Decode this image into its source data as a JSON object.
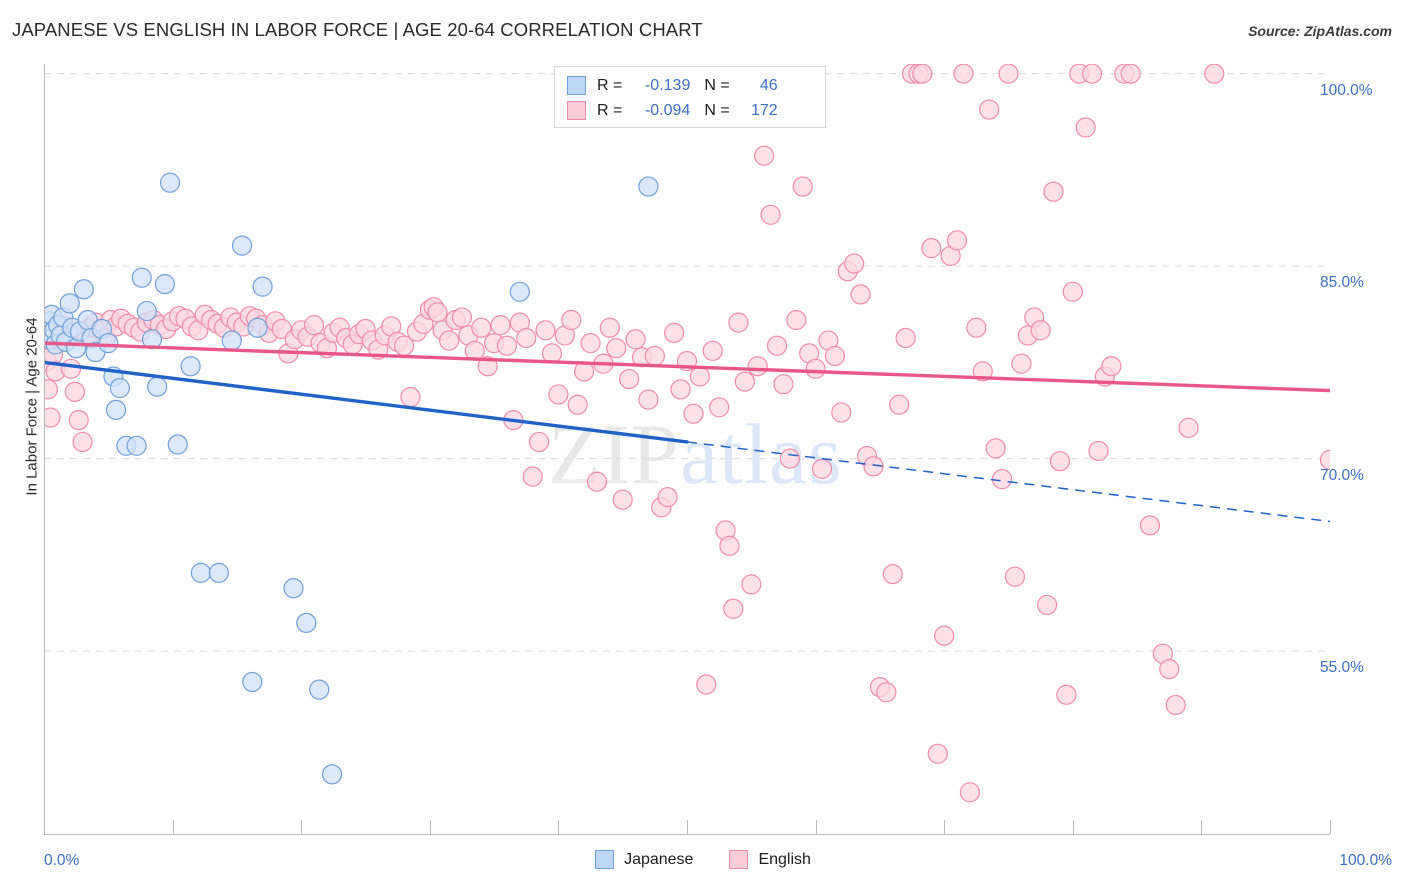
{
  "header": {
    "title": "JAPANESE VS ENGLISH IN LABOR FORCE | AGE 20-64 CORRELATION CHART",
    "source": "Source: ZipAtlas.com"
  },
  "watermark": {
    "part1": "ZIP",
    "part2": "atlas"
  },
  "stats_legend": {
    "rows": [
      {
        "series": "Japanese",
        "color": "#bcd6f5",
        "r_label": "R =",
        "r_value": "-0.139",
        "n_label": "N =",
        "n_value": "46"
      },
      {
        "series": "English",
        "color": "#fbccd9",
        "r_label": "R =",
        "r_value": "-0.094",
        "n_label": "N =",
        "n_value": "172"
      }
    ]
  },
  "series_legend": [
    {
      "label": "Japanese",
      "color": "#bcd6f5"
    },
    {
      "label": "English",
      "color": "#fbccd9"
    }
  ],
  "axes": {
    "y_title": "In Labor Force | Age 20-64",
    "y_ticks": [
      "100.0%",
      "85.0%",
      "70.0%",
      "55.0%"
    ],
    "x_min_label": "0.0%",
    "x_max_label": "100.0%"
  },
  "colors": {
    "blue_fill": "#cfe1f8",
    "blue_stroke": "#6f9fd8",
    "pink_fill": "#fcd7e2",
    "pink_stroke": "#f08aab",
    "blue_trend": "#1f63c8",
    "pink_trend": "#e8568a",
    "tick_text": "#3c6fc4",
    "grid": "#dcdcdc"
  },
  "chart_data": {
    "type": "scatter",
    "title": "JAPANESE VS ENGLISH IN LABOR FORCE | AGE 20-64 CORRELATION CHART",
    "xlabel": "",
    "ylabel": "In Labor Force | Age 20-64",
    "xlim": [
      0,
      100
    ],
    "ylim": [
      40.75,
      100.75
    ],
    "x_ticks": [
      0,
      10,
      20,
      30,
      40,
      50,
      60,
      70,
      80,
      90,
      100
    ],
    "y_gridlines": [
      100.0,
      85.0,
      70.0,
      55.0
    ],
    "grid": true,
    "legend_position": "bottom-center",
    "series": [
      {
        "name": "Japanese",
        "color": "#cfe1f8",
        "stroke": "#6f9fd8",
        "r": -0.139,
        "n": 46,
        "trend": {
          "x0": 0,
          "y0": 77.5,
          "x1": 50,
          "y1": 71.3,
          "solid_to_x": 50,
          "dashed_to": {
            "x": 100,
            "y": 65.1
          }
        },
        "points": [
          [
            0.2,
            79.8
          ],
          [
            0.4,
            80.7
          ],
          [
            0.5,
            79.3
          ],
          [
            0.6,
            81.2
          ],
          [
            0.8,
            80.0
          ],
          [
            0.9,
            78.9
          ],
          [
            1.1,
            80.4
          ],
          [
            1.3,
            79.6
          ],
          [
            1.5,
            81.0
          ],
          [
            1.7,
            79.1
          ],
          [
            2.0,
            82.1
          ],
          [
            2.2,
            80.2
          ],
          [
            2.5,
            78.6
          ],
          [
            2.8,
            79.9
          ],
          [
            3.1,
            83.2
          ],
          [
            3.4,
            80.8
          ],
          [
            3.7,
            79.4
          ],
          [
            4.0,
            78.3
          ],
          [
            4.5,
            80.1
          ],
          [
            5.0,
            79.0
          ],
          [
            5.4,
            76.4
          ],
          [
            5.6,
            73.8
          ],
          [
            5.9,
            75.5
          ],
          [
            6.4,
            71.0
          ],
          [
            7.2,
            71.0
          ],
          [
            7.6,
            84.1
          ],
          [
            8.0,
            81.5
          ],
          [
            8.4,
            79.3
          ],
          [
            8.8,
            75.6
          ],
          [
            9.4,
            83.6
          ],
          [
            9.8,
            91.5
          ],
          [
            10.4,
            71.1
          ],
          [
            11.4,
            77.2
          ],
          [
            12.2,
            61.1
          ],
          [
            13.6,
            61.1
          ],
          [
            14.6,
            79.2
          ],
          [
            15.4,
            86.6
          ],
          [
            16.2,
            52.6
          ],
          [
            16.6,
            80.2
          ],
          [
            17.0,
            83.4
          ],
          [
            19.4,
            59.9
          ],
          [
            20.4,
            57.2
          ],
          [
            21.4,
            52.0
          ],
          [
            22.4,
            45.4
          ],
          [
            37.0,
            83.0
          ],
          [
            47.0,
            91.2
          ]
        ]
      },
      {
        "name": "English",
        "color": "#fcd7e2",
        "stroke": "#f08aab",
        "r": -0.094,
        "n": 172,
        "trend": {
          "x0": 0,
          "y0": 79.0,
          "x1": 100,
          "y1": 75.3,
          "solid_to_x": 100
        },
        "points": [
          [
            0.2,
            77.6
          ],
          [
            0.3,
            75.4
          ],
          [
            0.5,
            73.2
          ],
          [
            0.7,
            78.1
          ],
          [
            0.9,
            76.8
          ],
          [
            1.2,
            79.2
          ],
          [
            1.5,
            80.4
          ],
          [
            1.8,
            79.8
          ],
          [
            2.1,
            77.0
          ],
          [
            2.4,
            75.2
          ],
          [
            2.7,
            73.0
          ],
          [
            3.0,
            71.3
          ],
          [
            3.3,
            79.6
          ],
          [
            3.6,
            80.2
          ],
          [
            4.0,
            80.6
          ],
          [
            4.4,
            80.1
          ],
          [
            4.8,
            79.4
          ],
          [
            5.2,
            80.8
          ],
          [
            5.6,
            80.3
          ],
          [
            6.0,
            80.9
          ],
          [
            6.5,
            80.5
          ],
          [
            7.0,
            80.2
          ],
          [
            7.5,
            79.9
          ],
          [
            8.0,
            80.6
          ],
          [
            8.5,
            80.8
          ],
          [
            9.0,
            80.4
          ],
          [
            9.5,
            80.1
          ],
          [
            10.0,
            80.7
          ],
          [
            10.5,
            81.1
          ],
          [
            11.0,
            80.9
          ],
          [
            11.5,
            80.3
          ],
          [
            12.0,
            80.0
          ],
          [
            12.5,
            81.2
          ],
          [
            13.0,
            80.8
          ],
          [
            13.5,
            80.5
          ],
          [
            14.0,
            80.2
          ],
          [
            14.5,
            81.0
          ],
          [
            15.0,
            80.6
          ],
          [
            15.5,
            80.3
          ],
          [
            16.0,
            81.1
          ],
          [
            16.5,
            80.9
          ],
          [
            17.0,
            80.4
          ],
          [
            17.5,
            79.8
          ],
          [
            18.0,
            80.7
          ],
          [
            18.5,
            80.1
          ],
          [
            19.0,
            78.2
          ],
          [
            19.5,
            79.3
          ],
          [
            20.0,
            80.0
          ],
          [
            20.5,
            79.5
          ],
          [
            21.0,
            80.4
          ],
          [
            21.5,
            79.0
          ],
          [
            22.0,
            78.6
          ],
          [
            22.5,
            79.8
          ],
          [
            23.0,
            80.2
          ],
          [
            23.5,
            79.4
          ],
          [
            24.0,
            78.9
          ],
          [
            24.5,
            79.7
          ],
          [
            25.0,
            80.1
          ],
          [
            25.5,
            79.2
          ],
          [
            26.0,
            78.5
          ],
          [
            26.5,
            79.6
          ],
          [
            27.0,
            80.3
          ],
          [
            27.5,
            79.1
          ],
          [
            28.0,
            78.8
          ],
          [
            28.5,
            74.8
          ],
          [
            29.0,
            79.9
          ],
          [
            29.5,
            80.5
          ],
          [
            30.0,
            81.6
          ],
          [
            30.3,
            81.8
          ],
          [
            30.6,
            81.4
          ],
          [
            31.0,
            80.0
          ],
          [
            31.5,
            79.2
          ],
          [
            32.0,
            80.8
          ],
          [
            32.5,
            81.0
          ],
          [
            33.0,
            79.6
          ],
          [
            33.5,
            78.4
          ],
          [
            34.0,
            80.2
          ],
          [
            34.5,
            77.2
          ],
          [
            35.0,
            79.0
          ],
          [
            35.5,
            80.4
          ],
          [
            36.0,
            78.8
          ],
          [
            36.5,
            73.0
          ],
          [
            37.0,
            80.6
          ],
          [
            37.5,
            79.4
          ],
          [
            38.0,
            68.6
          ],
          [
            38.5,
            71.3
          ],
          [
            39.0,
            80.0
          ],
          [
            39.5,
            78.2
          ],
          [
            40.0,
            75.0
          ],
          [
            40.5,
            79.6
          ],
          [
            41.0,
            80.8
          ],
          [
            41.5,
            74.2
          ],
          [
            42.0,
            76.8
          ],
          [
            42.5,
            79.0
          ],
          [
            43.0,
            68.2
          ],
          [
            43.5,
            77.4
          ],
          [
            44.0,
            80.2
          ],
          [
            44.5,
            78.6
          ],
          [
            45.0,
            66.8
          ],
          [
            45.5,
            76.2
          ],
          [
            46.0,
            79.3
          ],
          [
            46.5,
            77.9
          ],
          [
            47.0,
            74.6
          ],
          [
            47.5,
            78.0
          ],
          [
            48.0,
            66.2
          ],
          [
            48.5,
            67.0
          ],
          [
            49.0,
            79.8
          ],
          [
            49.5,
            75.4
          ],
          [
            50.0,
            77.6
          ],
          [
            50.5,
            73.5
          ],
          [
            51.0,
            76.4
          ],
          [
            51.5,
            52.4
          ],
          [
            52.0,
            78.4
          ],
          [
            52.5,
            74.0
          ],
          [
            53.0,
            64.4
          ],
          [
            53.3,
            63.2
          ],
          [
            53.6,
            58.3
          ],
          [
            54.0,
            80.6
          ],
          [
            54.5,
            76.0
          ],
          [
            55.0,
            60.2
          ],
          [
            55.5,
            77.2
          ],
          [
            56.0,
            93.6
          ],
          [
            56.5,
            89.0
          ],
          [
            57.0,
            78.8
          ],
          [
            57.5,
            75.8
          ],
          [
            58.0,
            70.0
          ],
          [
            58.5,
            80.8
          ],
          [
            59.0,
            91.2
          ],
          [
            59.5,
            78.2
          ],
          [
            60.0,
            77.0
          ],
          [
            60.5,
            69.2
          ],
          [
            61.0,
            79.2
          ],
          [
            61.5,
            78.0
          ],
          [
            62.0,
            73.6
          ],
          [
            62.5,
            84.6
          ],
          [
            63.0,
            85.2
          ],
          [
            63.5,
            82.8
          ],
          [
            64.0,
            70.2
          ],
          [
            64.5,
            69.4
          ],
          [
            65.0,
            52.2
          ],
          [
            65.5,
            51.8
          ],
          [
            66.0,
            61.0
          ],
          [
            66.5,
            74.2
          ],
          [
            67.0,
            79.4
          ],
          [
            67.5,
            100.0
          ],
          [
            68.0,
            100.0
          ],
          [
            68.3,
            100.0
          ],
          [
            69.0,
            86.4
          ],
          [
            69.5,
            47.0
          ],
          [
            70.0,
            56.2
          ],
          [
            70.5,
            85.8
          ],
          [
            71.0,
            87.0
          ],
          [
            71.5,
            100.0
          ],
          [
            72.0,
            44.0
          ],
          [
            72.5,
            80.2
          ],
          [
            73.0,
            76.8
          ],
          [
            73.5,
            97.2
          ],
          [
            74.0,
            70.8
          ],
          [
            74.5,
            68.4
          ],
          [
            75.0,
            100.0
          ],
          [
            75.5,
            60.8
          ],
          [
            76.0,
            77.4
          ],
          [
            76.5,
            79.6
          ],
          [
            77.0,
            81.0
          ],
          [
            77.5,
            80.0
          ],
          [
            78.0,
            58.6
          ],
          [
            78.5,
            90.8
          ],
          [
            79.0,
            69.8
          ],
          [
            79.5,
            51.6
          ],
          [
            80.0,
            83.0
          ],
          [
            80.5,
            100.0
          ],
          [
            81.0,
            95.8
          ],
          [
            81.5,
            100.0
          ],
          [
            82.0,
            70.6
          ],
          [
            82.5,
            76.4
          ],
          [
            83.0,
            77.2
          ],
          [
            84.0,
            100.0
          ],
          [
            84.5,
            100.0
          ],
          [
            86.0,
            64.8
          ],
          [
            87.0,
            54.8
          ],
          [
            87.5,
            53.6
          ],
          [
            88.0,
            50.8
          ],
          [
            89.0,
            72.4
          ],
          [
            91.0,
            100.0
          ],
          [
            100.0,
            69.9
          ]
        ]
      }
    ]
  }
}
